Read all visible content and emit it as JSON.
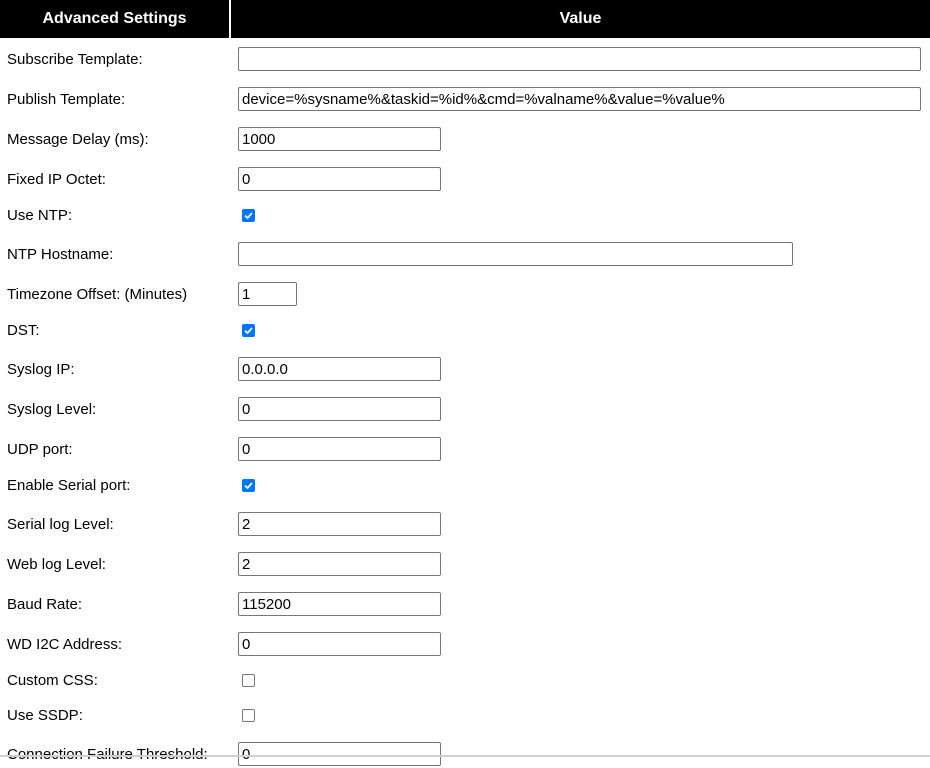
{
  "header": {
    "col1": "Advanced Settings",
    "col2": "Value"
  },
  "rows": {
    "subscribe_template": {
      "label": "Subscribe Template:",
      "value": ""
    },
    "publish_template": {
      "label": "Publish Template:",
      "value": "device=%sysname%&taskid=%id%&cmd=%valname%&value=%value%"
    },
    "message_delay": {
      "label": "Message Delay (ms):",
      "value": "1000"
    },
    "fixed_ip_octet": {
      "label": "Fixed IP Octet:",
      "value": "0"
    },
    "use_ntp": {
      "label": "Use NTP:",
      "checked": true
    },
    "ntp_hostname": {
      "label": "NTP Hostname:",
      "value": ""
    },
    "timezone_offset": {
      "label": "Timezone Offset: (Minutes)",
      "value": "1"
    },
    "dst": {
      "label": "DST:",
      "checked": true
    },
    "syslog_ip": {
      "label": "Syslog IP:",
      "value": "0.0.0.0"
    },
    "syslog_level": {
      "label": "Syslog Level:",
      "value": "0"
    },
    "udp_port": {
      "label": "UDP port:",
      "value": "0"
    },
    "enable_serial": {
      "label": "Enable Serial port:",
      "checked": true
    },
    "serial_log_level": {
      "label": "Serial log Level:",
      "value": "2"
    },
    "web_log_level": {
      "label": "Web log Level:",
      "value": "2"
    },
    "baud_rate": {
      "label": "Baud Rate:",
      "value": "115200"
    },
    "wd_i2c_address": {
      "label": "WD I2C Address:",
      "value": "0"
    },
    "custom_css": {
      "label": "Custom CSS:",
      "checked": false
    },
    "use_ssdp": {
      "label": "Use SSDP:",
      "checked": false
    },
    "connection_failure_threshold": {
      "label": "Connection Failure Threshold:",
      "value": "0"
    }
  },
  "colors": {
    "header_bg": "#000000",
    "checkbox_accent": "#0075ff"
  }
}
